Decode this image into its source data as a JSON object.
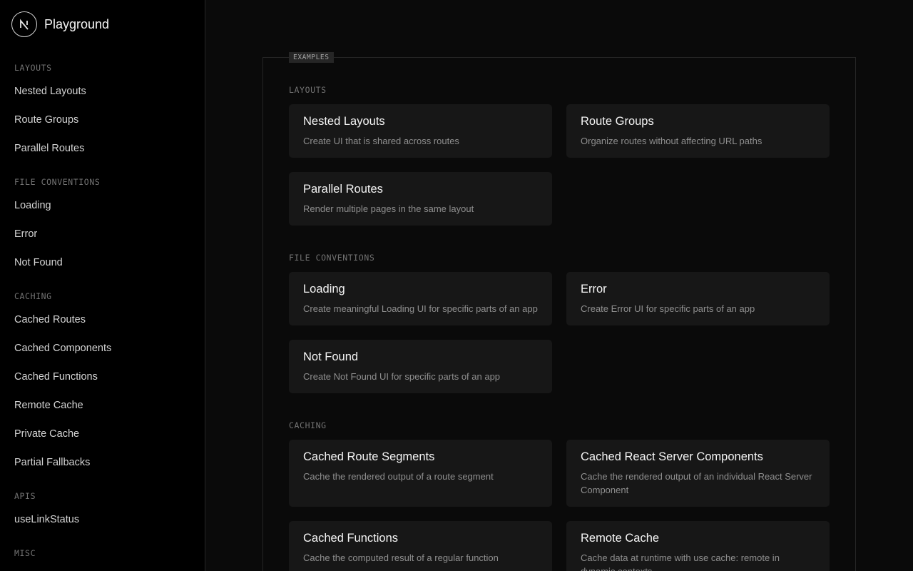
{
  "app": {
    "name": "Playground",
    "logo_letter": "N"
  },
  "sidebar": {
    "groups": [
      {
        "title": "LAYOUTS",
        "items": [
          "Nested Layouts",
          "Route Groups",
          "Parallel Routes"
        ]
      },
      {
        "title": "FILE CONVENTIONS",
        "items": [
          "Loading",
          "Error",
          "Not Found"
        ]
      },
      {
        "title": "CACHING",
        "items": [
          "Cached Routes",
          "Cached Components",
          "Cached Functions",
          "Remote Cache",
          "Private Cache",
          "Partial Fallbacks"
        ]
      },
      {
        "title": "APIS",
        "items": [
          "useLinkStatus"
        ]
      },
      {
        "title": "MISC",
        "items": []
      }
    ]
  },
  "main": {
    "panel_tag": "EXAMPLES",
    "sections": [
      {
        "title": "LAYOUTS",
        "cards": [
          {
            "title": "Nested Layouts",
            "desc": "Create UI that is shared across routes"
          },
          {
            "title": "Route Groups",
            "desc": "Organize routes without affecting URL paths"
          },
          {
            "title": "Parallel Routes",
            "desc": "Render multiple pages in the same layout"
          }
        ]
      },
      {
        "title": "FILE CONVENTIONS",
        "cards": [
          {
            "title": "Loading",
            "desc": "Create meaningful Loading UI for specific parts of an app"
          },
          {
            "title": "Error",
            "desc": "Create Error UI for specific parts of an app"
          },
          {
            "title": "Not Found",
            "desc": "Create Not Found UI for specific parts of an app"
          }
        ]
      },
      {
        "title": "CACHING",
        "cards": [
          {
            "title": "Cached Route Segments",
            "desc": "Cache the rendered output of a route segment"
          },
          {
            "title": "Cached React Server Components",
            "desc": "Cache the rendered output of an individual React Server Component"
          },
          {
            "title": "Cached Functions",
            "desc": "Cache the computed result of a regular function"
          },
          {
            "title": "Remote Cache",
            "desc": "Cache data at runtime with use cache: remote in dynamic contexts"
          }
        ]
      }
    ]
  }
}
